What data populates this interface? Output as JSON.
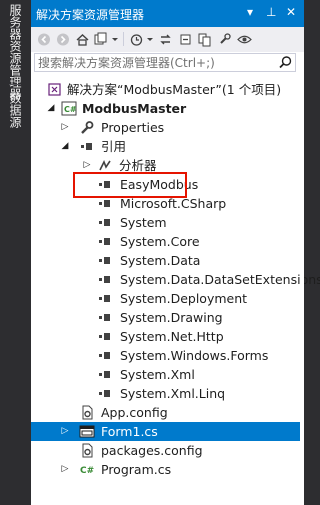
{
  "side_tabs": {
    "tab1": "服务器资源管理器",
    "tab2": "数据源"
  },
  "panel": {
    "title": "解决方案资源管理器",
    "pin_glyph": "⊥",
    "close_glyph": "✕",
    "dropdown_glyph": "▾"
  },
  "search": {
    "placeholder": "搜索解决方案资源管理器(Ctrl+;)"
  },
  "tree": {
    "solution": "解决方案“ModbusMaster”(1 个项目)",
    "project": "ModbusMaster",
    "properties": "Properties",
    "references": "引用",
    "analyzers": "分析器",
    "refs": [
      "EasyModbus",
      "Microsoft.CSharp",
      "System",
      "System.Core",
      "System.Data",
      "System.Data.DataSetExtensions",
      "System.Deployment",
      "System.Drawing",
      "System.Net.Http",
      "System.Windows.Forms",
      "System.Xml",
      "System.Xml.Linq"
    ],
    "app_config": "App.config",
    "form1": "Form1.cs",
    "packages_config": "packages.config",
    "program": "Program.cs"
  },
  "colors": {
    "accent": "#007acc",
    "highlight_box": "#e51400"
  }
}
